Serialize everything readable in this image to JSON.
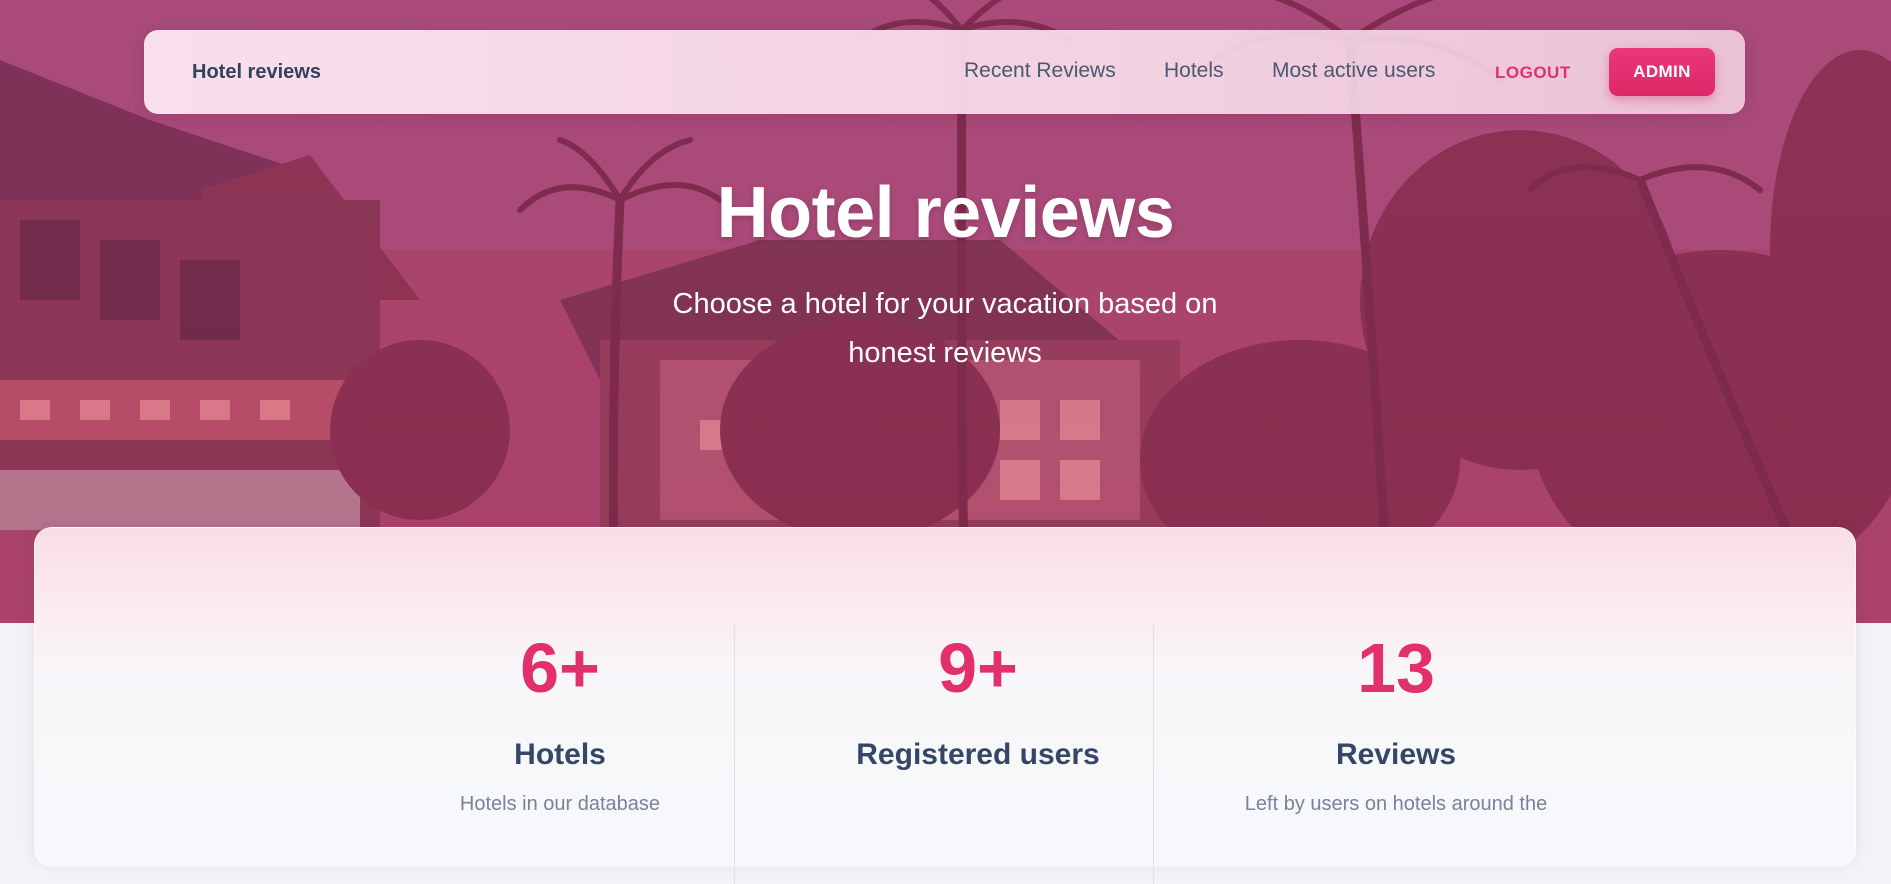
{
  "navbar": {
    "brand": "Hotel reviews",
    "links": [
      "Recent Reviews",
      "Hotels",
      "Most active users"
    ],
    "logout_label": "LOGOUT",
    "admin_label": "ADMIN"
  },
  "hero": {
    "title": "Hotel reviews",
    "subtitle": "Choose a hotel for your vacation based on honest reviews"
  },
  "stats": [
    {
      "number": "6+",
      "label": "Hotels",
      "description": "Hotels in our database"
    },
    {
      "number": "9+",
      "label": "Registered users",
      "description": ""
    },
    {
      "number": "13",
      "label": "Reviews",
      "description": "Left by users on hotels around the"
    }
  ],
  "colors": {
    "accent": "#e1306c",
    "heading": "#354666",
    "hero_tint": "#a9476f"
  }
}
